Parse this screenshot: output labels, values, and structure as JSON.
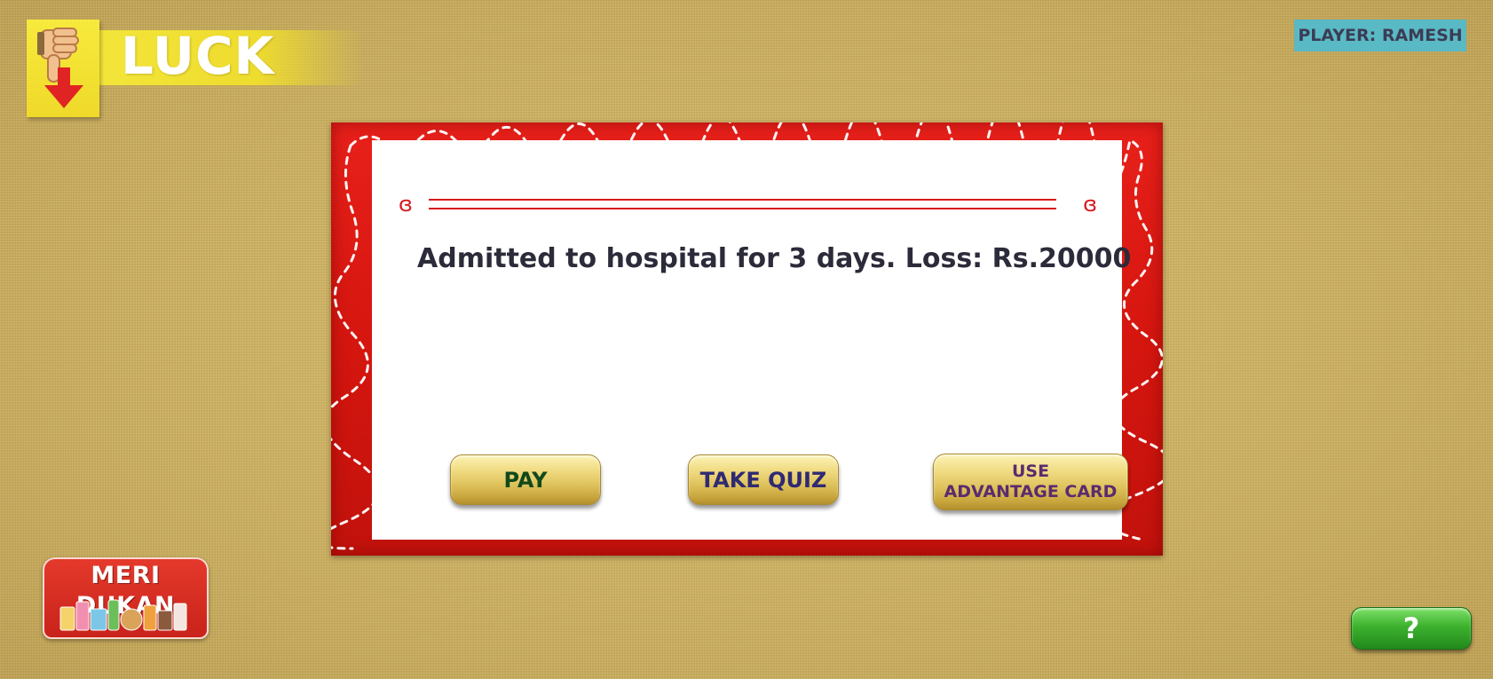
{
  "header": {
    "title": "LUCK",
    "icon": "thumbs-down-arrow-icon"
  },
  "player": {
    "label": "PLAYER: RAMESH"
  },
  "card": {
    "message": "Admitted to hospital for 3 days. Loss: Rs.20000",
    "buttons": {
      "pay": "PAY",
      "take_quiz": "TAKE QUIZ",
      "advantage_line1": "USE",
      "advantage_line2": "ADVANTAGE CARD"
    }
  },
  "logo": {
    "text": "MERI DUKAN"
  },
  "help": {
    "label": "?"
  },
  "colors": {
    "background": "#cfb25e",
    "card_frame": "#d5160f",
    "banner_yellow": "#f3e53a",
    "player_label_bg": "#59b9c4",
    "help_green": "#3db22e"
  }
}
